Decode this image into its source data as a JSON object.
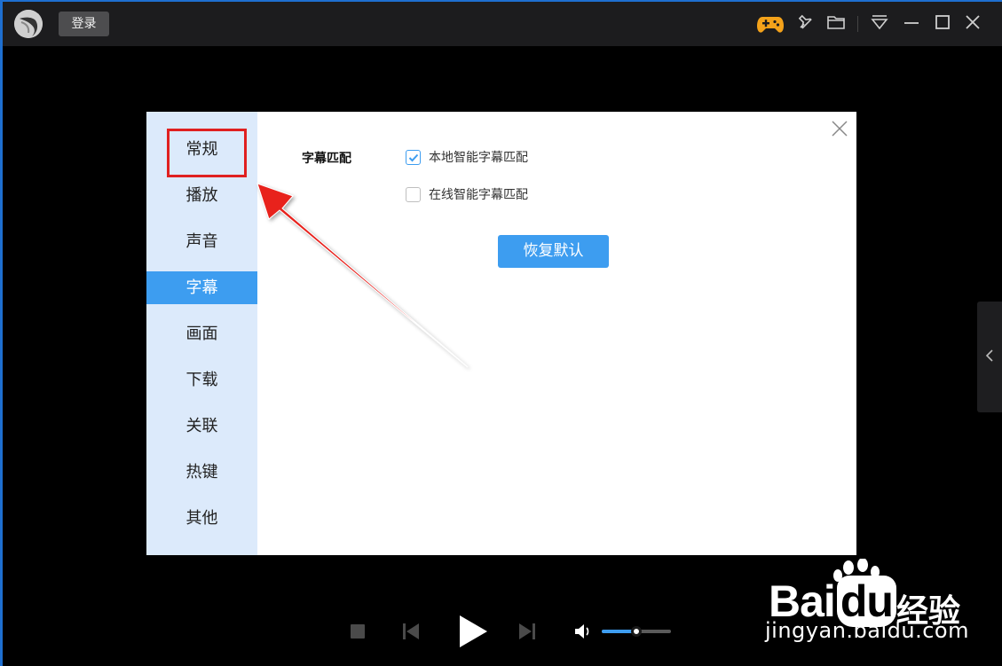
{
  "titlebar": {
    "login_label": "登录",
    "icons": [
      "logo-icon",
      "gamepad-icon",
      "pin-icon",
      "folder-icon",
      "menu-icon",
      "minimize-icon",
      "maximize-icon",
      "close-icon"
    ]
  },
  "settings": {
    "nav": [
      {
        "label": "常规",
        "active": false
      },
      {
        "label": "播放",
        "active": false
      },
      {
        "label": "声音",
        "active": false
      },
      {
        "label": "字幕",
        "active": true
      },
      {
        "label": "画面",
        "active": false
      },
      {
        "label": "下载",
        "active": false
      },
      {
        "label": "关联",
        "active": false
      },
      {
        "label": "热键",
        "active": false
      },
      {
        "label": "其他",
        "active": false
      }
    ],
    "section_label": "字幕匹配",
    "options": [
      {
        "label": "本地智能字幕匹配",
        "checked": true
      },
      {
        "label": "在线智能字幕匹配",
        "checked": false
      }
    ],
    "restore_label": "恢复默认"
  },
  "player": {
    "volume": 0.5
  },
  "watermark": {
    "brand": "Bai",
    "brand_suffix": "du",
    "product": "经验",
    "url": "jingyan.baidu.com"
  },
  "colors": {
    "accent": "#3d9df0",
    "nav_bg": "#dceafb",
    "annotation": "#e02020",
    "titlebar_bg": "#1c1c1e"
  }
}
